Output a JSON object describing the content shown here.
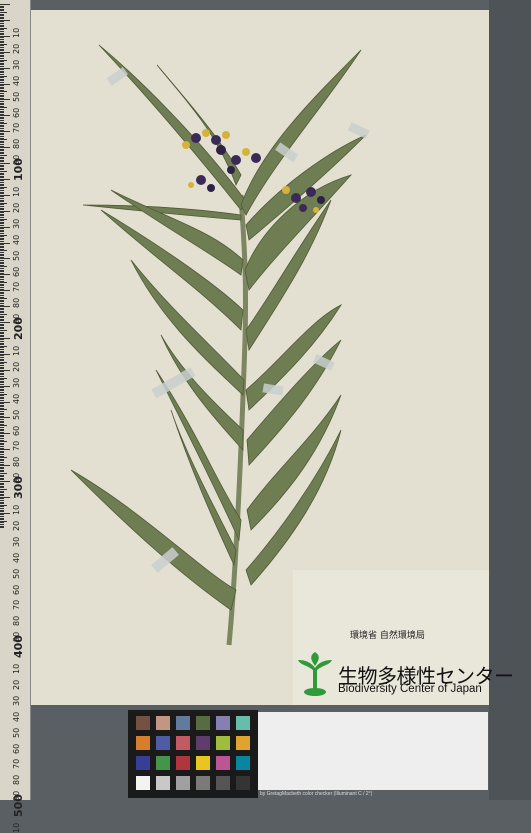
{
  "ruler": {
    "labels": [
      "10",
      "20",
      "30",
      "40",
      "50",
      "60",
      "70",
      "80",
      "90",
      "100",
      "10",
      "20",
      "30",
      "40",
      "50",
      "60",
      "70",
      "80",
      "90",
      "200",
      "10",
      "20",
      "30",
      "40",
      "50",
      "60",
      "70",
      "80",
      "90",
      "300",
      "10",
      "20",
      "30",
      "40",
      "50",
      "60",
      "70",
      "80",
      "90",
      "400",
      "10",
      "20",
      "30",
      "40",
      "50",
      "60",
      "70",
      "80",
      "90",
      "500",
      "10"
    ]
  },
  "label": {
    "ministry": "環境省 自然環境局",
    "center_jp": "生物多様性センター",
    "center_en": "Biodiversity Center of Japan"
  },
  "calibration": {
    "caption": "by GretagMacbeth color checker (Illuminant C / 2°)"
  },
  "colors": {
    "sheet": "#e4e0d1",
    "leaf": "#6f7d52",
    "flower": "#3b2a55",
    "logo_green": "#2f9a3a"
  }
}
